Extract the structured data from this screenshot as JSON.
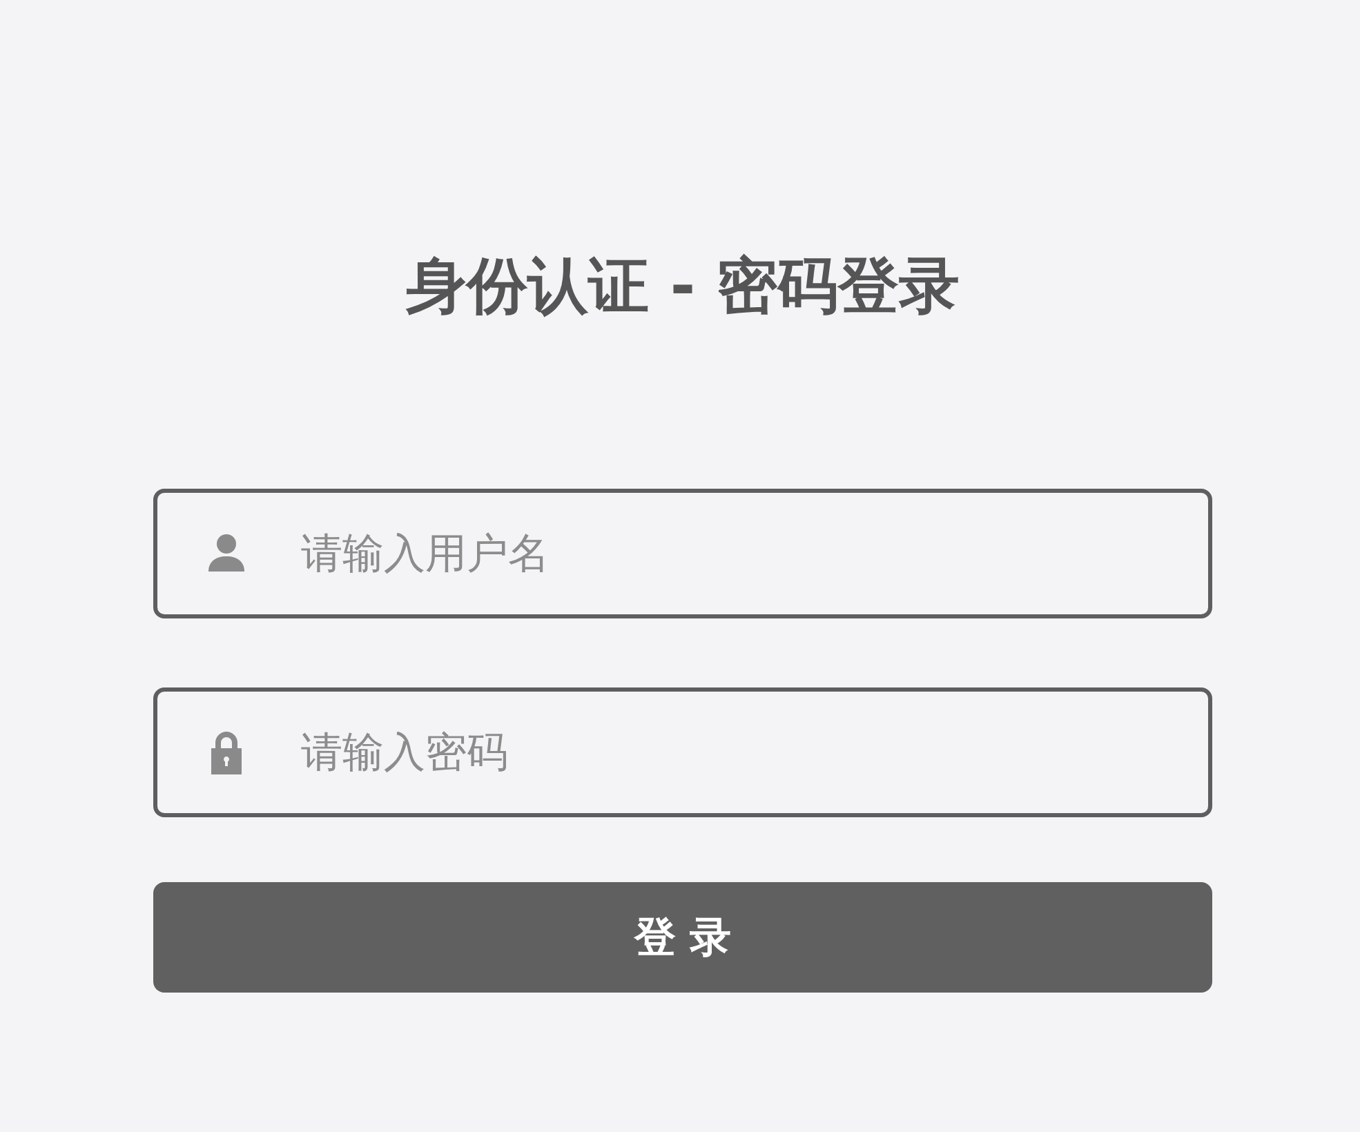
{
  "title": "身份认证 - 密码登录",
  "fields": [
    {
      "kind": "username",
      "placeholder": "请输入用户名"
    },
    {
      "kind": "password",
      "placeholder": "请输入密码"
    }
  ],
  "submit_button": "登 录"
}
